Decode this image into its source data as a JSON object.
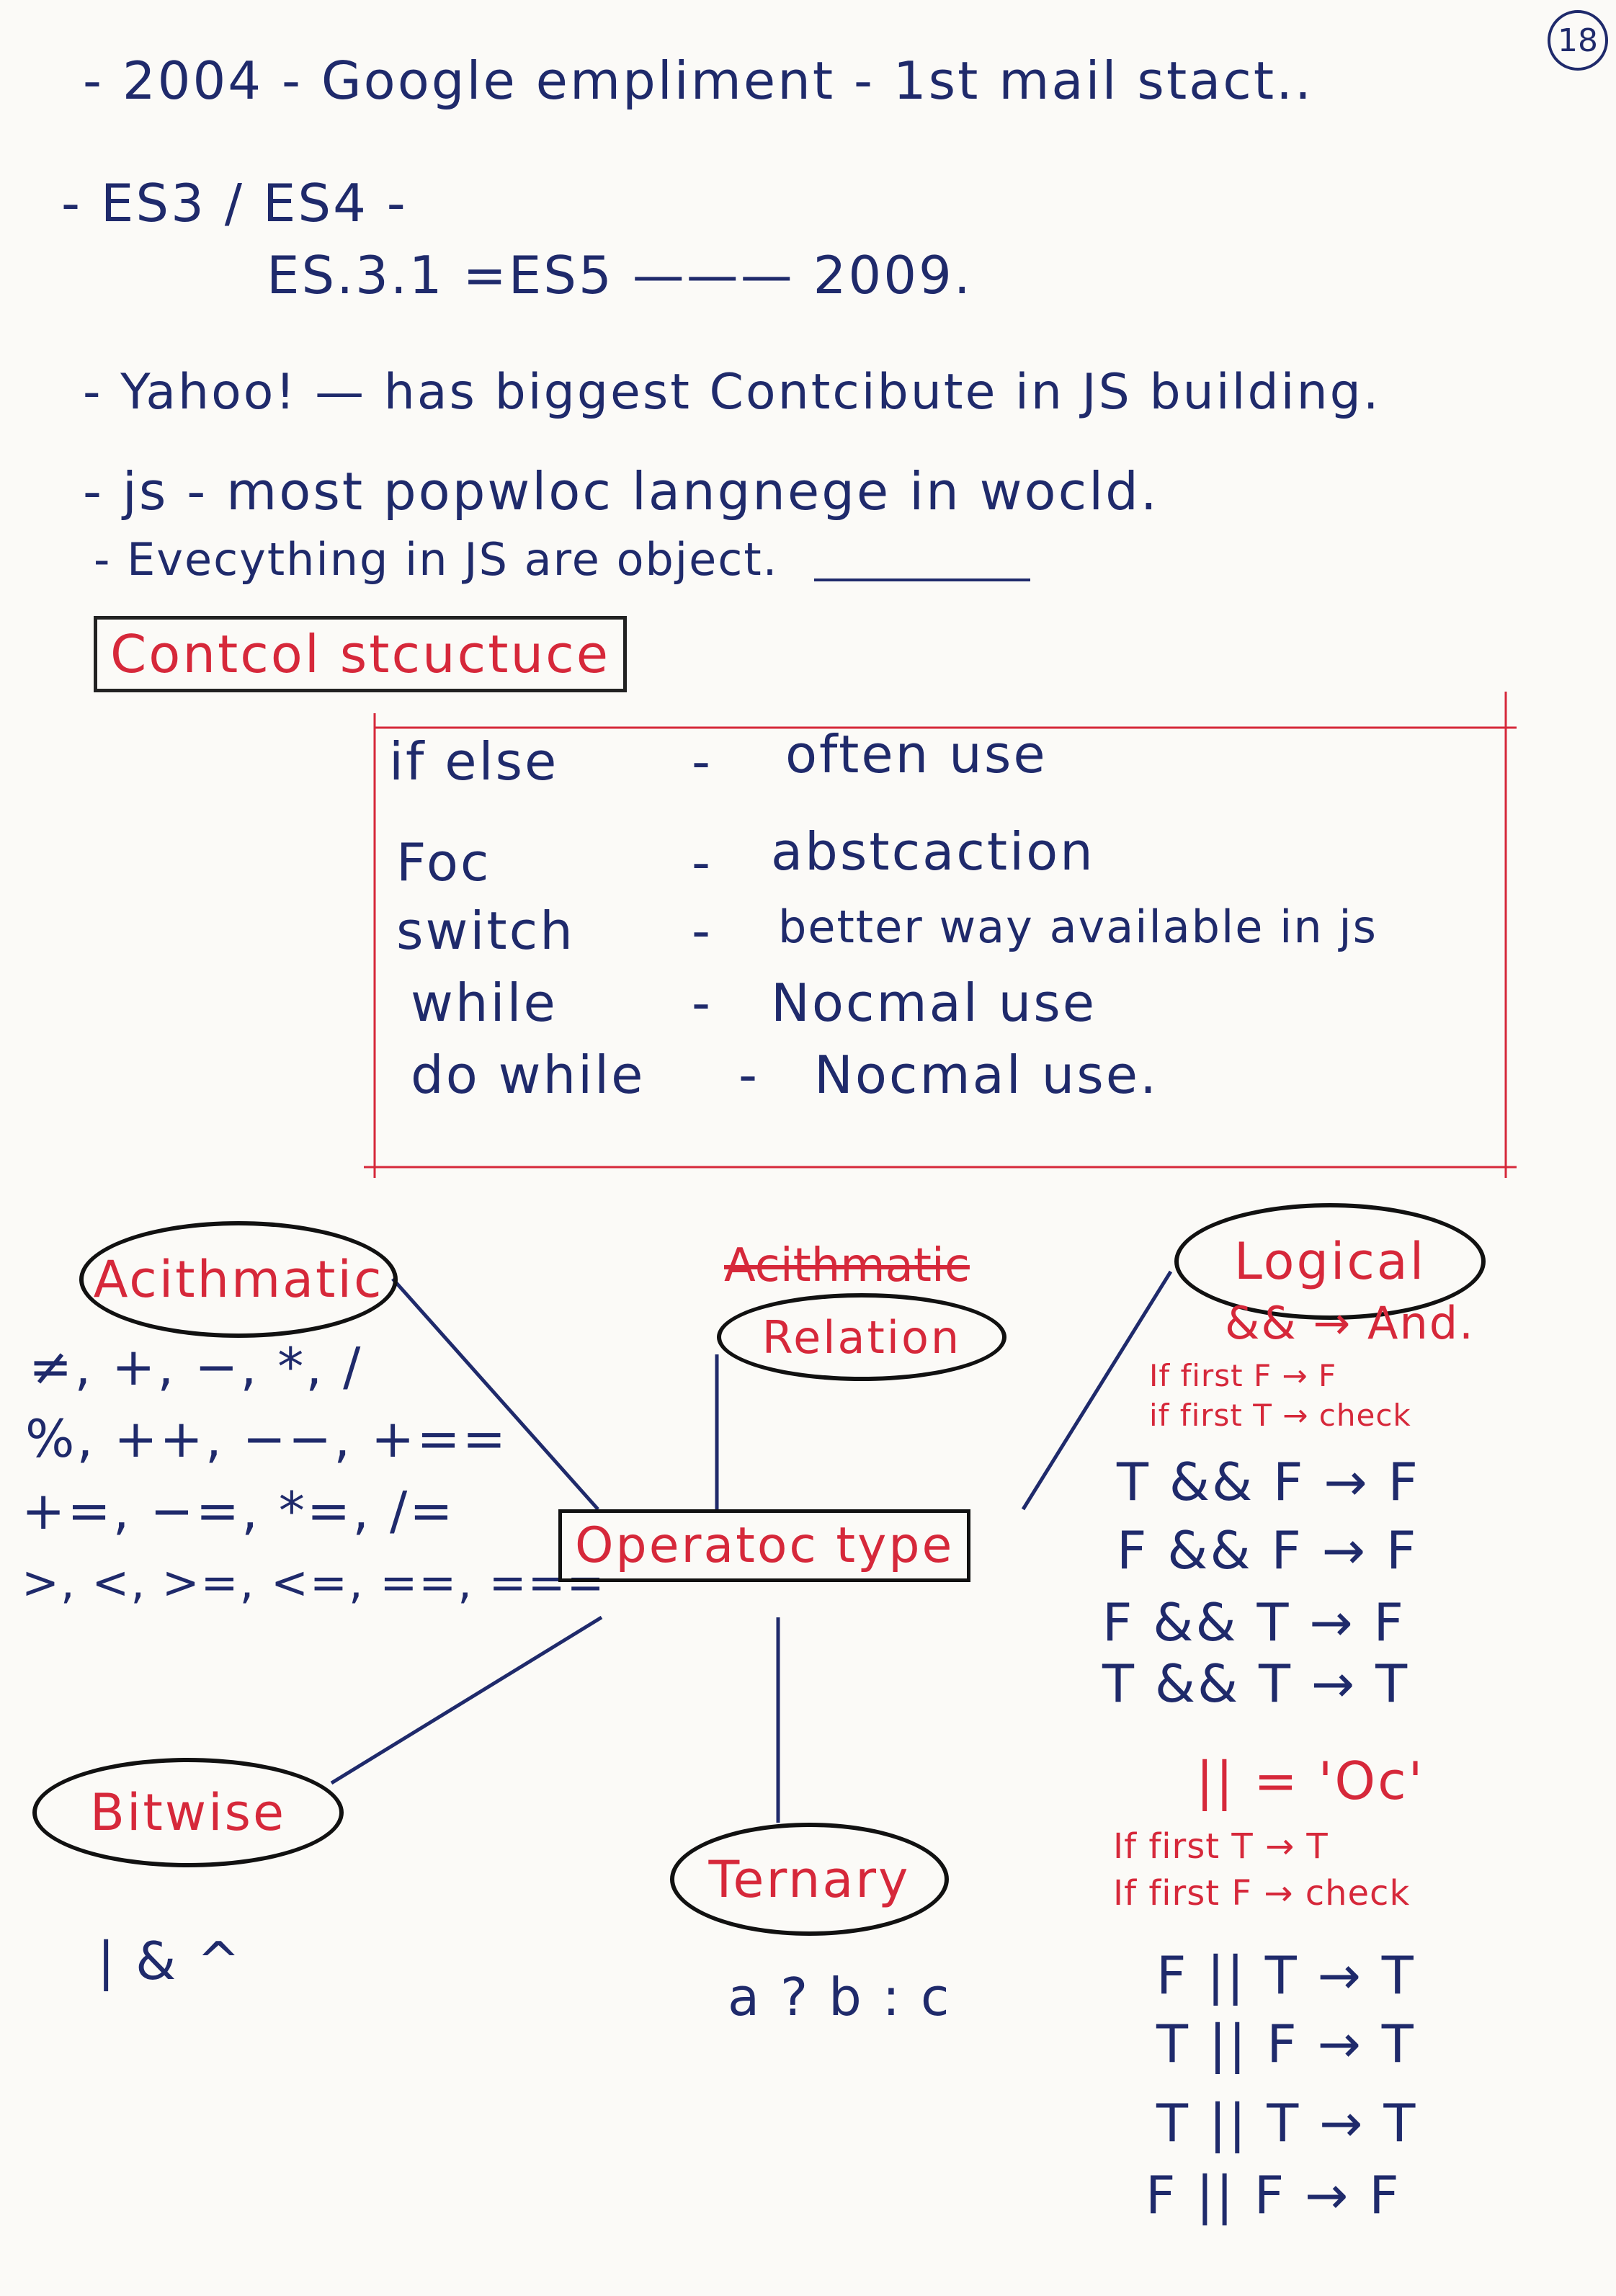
{
  "page_number": "18",
  "history_notes": {
    "line1": "- 2004  - Google empliment  - 1st mail stact..",
    "line2": "- ES3 / ES4 -",
    "line3": "ES.3.1 =ES5  ———  2009.",
    "line4": "- Yahoo! — has biggest Contcibute in JS building.",
    "line5": "- js - most popwloc langnege in wocld.",
    "line6": "- Evecything in JS are object."
  },
  "control_structure": {
    "heading": "Contcol stcuctuce",
    "rows": [
      {
        "keyword": "if  else",
        "dash": "-",
        "desc": "often use"
      },
      {
        "keyword": "Foc",
        "dash": "-",
        "desc": "abstcaction"
      },
      {
        "keyword": "switch",
        "dash": "-",
        "desc": "better way available in js"
      },
      {
        "keyword": "while",
        "dash": "-",
        "desc": "Nocmal use"
      },
      {
        "keyword": "do while",
        "dash": "-",
        "desc": "Nocmal use."
      }
    ]
  },
  "operators": {
    "center": "Operatoc type",
    "arithmatic": {
      "label": "Acithmatic",
      "lines": [
        "≠, +, −, *, /",
        "%, ++, −−, +==",
        "+=, −=, *=, /=",
        ">, <, >=, <=, ==, ==="
      ]
    },
    "relation": {
      "struck": "Acithmatic",
      "label": "Relation"
    },
    "logical": {
      "label": "Logical",
      "and_heading": "&& → And.",
      "and_rules": [
        "If first F → F",
        "if first  T → check"
      ],
      "and_table": [
        "T && F → F",
        "F && F → F",
        "F && T → F",
        "T && T → T"
      ],
      "or_heading": "|| = 'Oc'",
      "or_rules": [
        "If first T → T",
        "If first F → check"
      ],
      "or_table": [
        "F || T → T",
        "T || F → T",
        "T || T → T",
        "F || F → F"
      ]
    },
    "bitwise": {
      "label": "Bitwise",
      "symbols": "|  &  ^"
    },
    "ternary": {
      "label": "Ternary",
      "syntax": "a ? b : c"
    }
  },
  "colors": {
    "ink_blue": "#1f2a6b",
    "ink_red": "#d6283a",
    "paper": "#fbfaf7"
  }
}
